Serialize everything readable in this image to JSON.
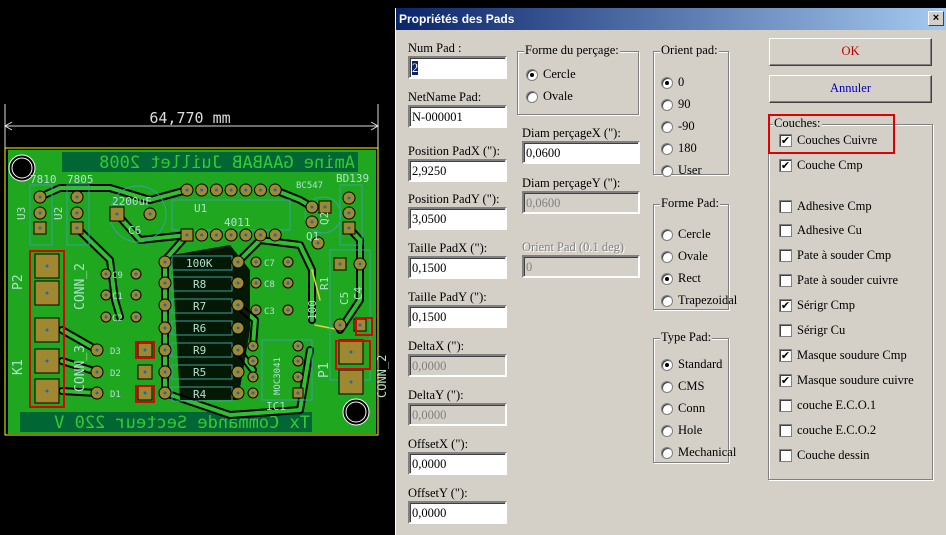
{
  "pcb": {
    "dimension": "64,770 mm",
    "title_text": "Amine GAABAB Juillet 2008",
    "footer_text": "Tx Commande Secteur 220 V",
    "labels": [
      "7810",
      "7805",
      "2200uF",
      "C6",
      "U1",
      "4011",
      "BC547",
      "BD139",
      "U3",
      "U2",
      "P2",
      "K1",
      "CONN_2",
      "CONN_3",
      "Q1",
      "Q2",
      "R1",
      "100",
      "C5",
      "C4",
      "P1",
      "IC1",
      "CONN_2",
      "100K",
      "R8",
      "R7",
      "R6",
      "R9",
      "R5",
      "R4",
      "C7",
      "C8",
      "C3",
      "C9",
      "C1",
      "C2",
      "D3",
      "D2",
      "D1",
      "MOC3041"
    ],
    "colors": {
      "board": "#1fa81f",
      "silk": "#9fd3c0",
      "pad": "#a08830",
      "highlight": "#e00000"
    }
  },
  "dialog": {
    "title": "Propriétés des Pads",
    "close": "×",
    "fields": {
      "num_pad": {
        "label": "Num Pad :",
        "value": "2"
      },
      "netname": {
        "label": "NetName Pad:",
        "value": "N-000001"
      },
      "posx": {
        "label": "Position PadX (\"):",
        "value": "2,9250"
      },
      "posy": {
        "label": "Position PadY (\"):",
        "value": "3,0500"
      },
      "taillex": {
        "label": "Taille PadX (\"):",
        "value": "0,1500"
      },
      "tailley": {
        "label": "Taille PadY (\"):",
        "value": "0,1500"
      },
      "deltax": {
        "label": "DeltaX (\"):",
        "value": "0,0000"
      },
      "deltay": {
        "label": "DeltaY (\"):",
        "value": "0,0000"
      },
      "offsetx": {
        "label": "OffsetX (\"):",
        "value": "0,0000"
      },
      "offsety": {
        "label": "OffsetY (\"):",
        "value": "0,0000"
      },
      "diamx": {
        "label": "Diam perçageX (\"):",
        "value": "0,0600"
      },
      "diamy": {
        "label": "Diam perçageY (\"):",
        "value": "0,0600"
      },
      "orient": {
        "label": "Orient Pad (0.1 deg)",
        "value": "0"
      }
    },
    "forme_percage": {
      "label": "Forme du perçage:",
      "options": [
        "Cercle",
        "Ovale"
      ],
      "selected": "Cercle"
    },
    "orient_pad": {
      "label": "Orient pad:",
      "options": [
        "0",
        "90",
        "-90",
        "180",
        "User"
      ],
      "selected": "0"
    },
    "forme_pad": {
      "label": "Forme Pad:",
      "options": [
        "Cercle",
        "Ovale",
        "Rect",
        "Trapezoidal"
      ],
      "selected": "Rect"
    },
    "type_pad": {
      "label": "Type Pad:",
      "options": [
        "Standard",
        "CMS",
        "Conn",
        "Hole",
        "Mechanical"
      ],
      "selected": "Standard"
    },
    "ok": "OK",
    "cancel": "Annuler",
    "couches": {
      "label": "Couches:",
      "items": [
        {
          "label": "Couches Cuivre",
          "checked": true
        },
        {
          "label": "Couche Cmp",
          "checked": true
        },
        {
          "label": "Adhesive Cmp",
          "checked": false
        },
        {
          "label": "Adhesive Cu",
          "checked": false
        },
        {
          "label": "Pate à souder Cmp",
          "checked": false
        },
        {
          "label": "Pate à souder cuivre",
          "checked": false
        },
        {
          "label": "Sérigr Cmp",
          "checked": true
        },
        {
          "label": "Sérigr Cu",
          "checked": false
        },
        {
          "label": "Masque soudure Cmp",
          "checked": true
        },
        {
          "label": "Masque soudure cuivre",
          "checked": true
        },
        {
          "label": "couche E.C.O.1",
          "checked": false
        },
        {
          "label": "couche E.C.O.2",
          "checked": false
        },
        {
          "label": "Couche dessin",
          "checked": false
        }
      ]
    }
  }
}
